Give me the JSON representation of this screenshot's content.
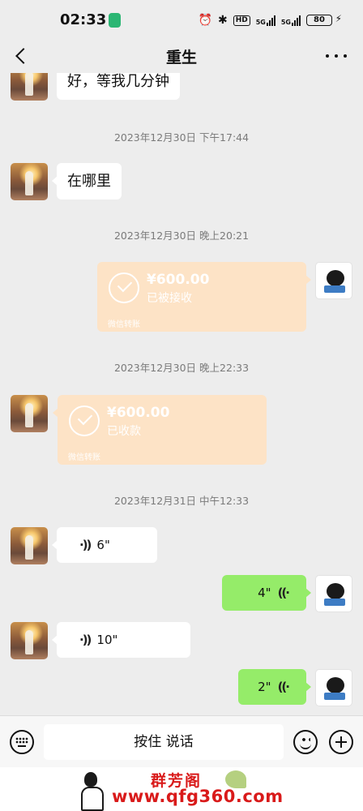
{
  "status_bar": {
    "time": "02:33",
    "hd_label": "HD",
    "network_1": "5G",
    "network_2": "5G",
    "battery": "80"
  },
  "header": {
    "title": "重生"
  },
  "messages": [
    {
      "type": "text",
      "side": "left",
      "text": "好，等我几分钟"
    },
    {
      "type": "timestamp",
      "text": "2023年12月30日 下午17:44"
    },
    {
      "type": "text",
      "side": "left",
      "text": "在哪里"
    },
    {
      "type": "timestamp",
      "text": "2023年12月30日 晚上20:21"
    },
    {
      "type": "transfer",
      "side": "right",
      "amount": "¥600.00",
      "status": "已被接收",
      "footer": "微信转账"
    },
    {
      "type": "timestamp",
      "text": "2023年12月30日 晚上22:33"
    },
    {
      "type": "transfer",
      "side": "left",
      "amount": "¥600.00",
      "status": "已收款",
      "footer": "微信转账"
    },
    {
      "type": "timestamp",
      "text": "2023年12月31日 中午12:33"
    },
    {
      "type": "voice",
      "side": "left",
      "duration": "6\""
    },
    {
      "type": "voice",
      "side": "right",
      "duration": "4\""
    },
    {
      "type": "voice",
      "side": "left",
      "duration": "10\""
    },
    {
      "type": "voice",
      "side": "right",
      "duration": "2\""
    }
  ],
  "input_bar": {
    "talk_label": "按住 说话"
  },
  "icons": {
    "back": "chevron-left-icon",
    "more": "more-dots-icon",
    "keyboard": "keyboard-icon",
    "emoji": "emoji-icon",
    "plus": "plus-icon",
    "voice_wave": "voice-wave-icon"
  },
  "colors": {
    "background": "#ededed",
    "sent_bubble": "#95ec69",
    "received_bubble": "#ffffff",
    "transfer_card": "#fde3c6",
    "watermark_red": "#d91a1a"
  },
  "watermark": {
    "name": "群芳阁",
    "url": "www.qfg360.com"
  }
}
